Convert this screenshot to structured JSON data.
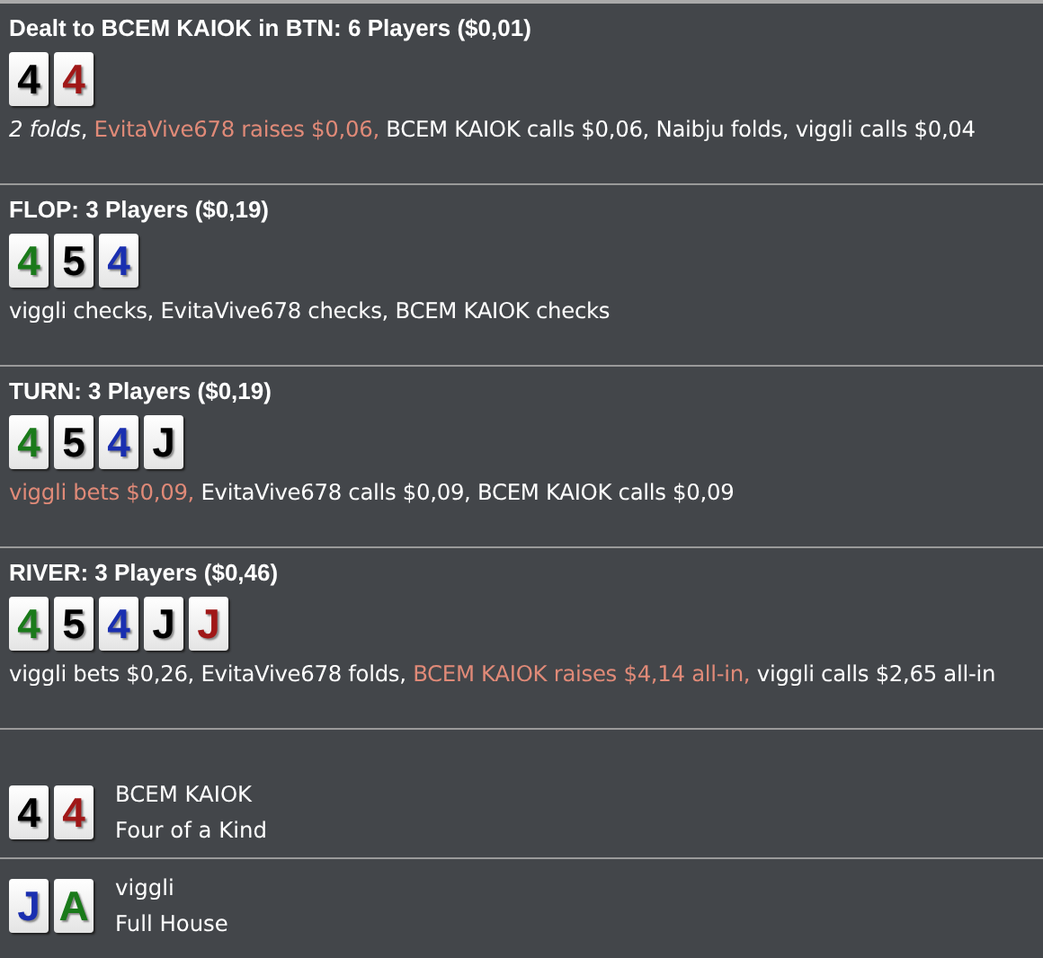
{
  "streets": [
    {
      "title": "Dealt to BCEM KAIOK in BTN: 6 Players ($0,01)",
      "cards": [
        {
          "rank": "4",
          "color": "#000000"
        },
        {
          "rank": "4",
          "color": "#a01818"
        }
      ],
      "actions": [
        {
          "text": "*2 folds*, ",
          "aggressive": false
        },
        {
          "text": "EvitaVive678 raises $0,06, ",
          "aggressive": true
        },
        {
          "text": "BCEM KAIOK calls $0,06, Naibju folds, viggli calls $0,04",
          "aggressive": false
        }
      ]
    },
    {
      "title": "FLOP: 3 Players ($0,19)",
      "cards": [
        {
          "rank": "4",
          "color": "#1a7a1a"
        },
        {
          "rank": "5",
          "color": "#000000"
        },
        {
          "rank": "4",
          "color": "#1a2fb0"
        }
      ],
      "actions": [
        {
          "text": "viggli checks, EvitaVive678 checks, BCEM KAIOK checks",
          "aggressive": false
        }
      ]
    },
    {
      "title": "TURN: 3 Players ($0,19)",
      "cards": [
        {
          "rank": "4",
          "color": "#1a7a1a"
        },
        {
          "rank": "5",
          "color": "#000000"
        },
        {
          "rank": "4",
          "color": "#1a2fb0"
        },
        {
          "rank": "J",
          "color": "#000000"
        }
      ],
      "actions": [
        {
          "text": "viggli bets $0,09, ",
          "aggressive": true
        },
        {
          "text": "EvitaVive678 calls $0,09, BCEM KAIOK calls $0,09",
          "aggressive": false
        }
      ]
    },
    {
      "title": "RIVER: 3 Players ($0,46)",
      "cards": [
        {
          "rank": "4",
          "color": "#1a7a1a"
        },
        {
          "rank": "5",
          "color": "#000000"
        },
        {
          "rank": "4",
          "color": "#1a2fb0"
        },
        {
          "rank": "J",
          "color": "#000000"
        },
        {
          "rank": "J",
          "color": "#a01818"
        }
      ],
      "actions": [
        {
          "text": "viggli bets $0,26, EvitaVive678 folds, ",
          "aggressive": false
        },
        {
          "text": "BCEM KAIOK raises $4,14 all-in, ",
          "aggressive": true
        },
        {
          "text": "viggli calls $2,65 all-in",
          "aggressive": false
        }
      ]
    }
  ],
  "showdown": [
    {
      "player": "BCEM KAIOK",
      "hand": "Four of a Kind",
      "cards": [
        {
          "rank": "4",
          "color": "#000000"
        },
        {
          "rank": "4",
          "color": "#a01818"
        }
      ]
    },
    {
      "player": "viggli",
      "hand": "Full House",
      "cards": [
        {
          "rank": "J",
          "color": "#1a2fb0"
        },
        {
          "rank": "A",
          "color": "#1a7a1a"
        }
      ]
    }
  ]
}
